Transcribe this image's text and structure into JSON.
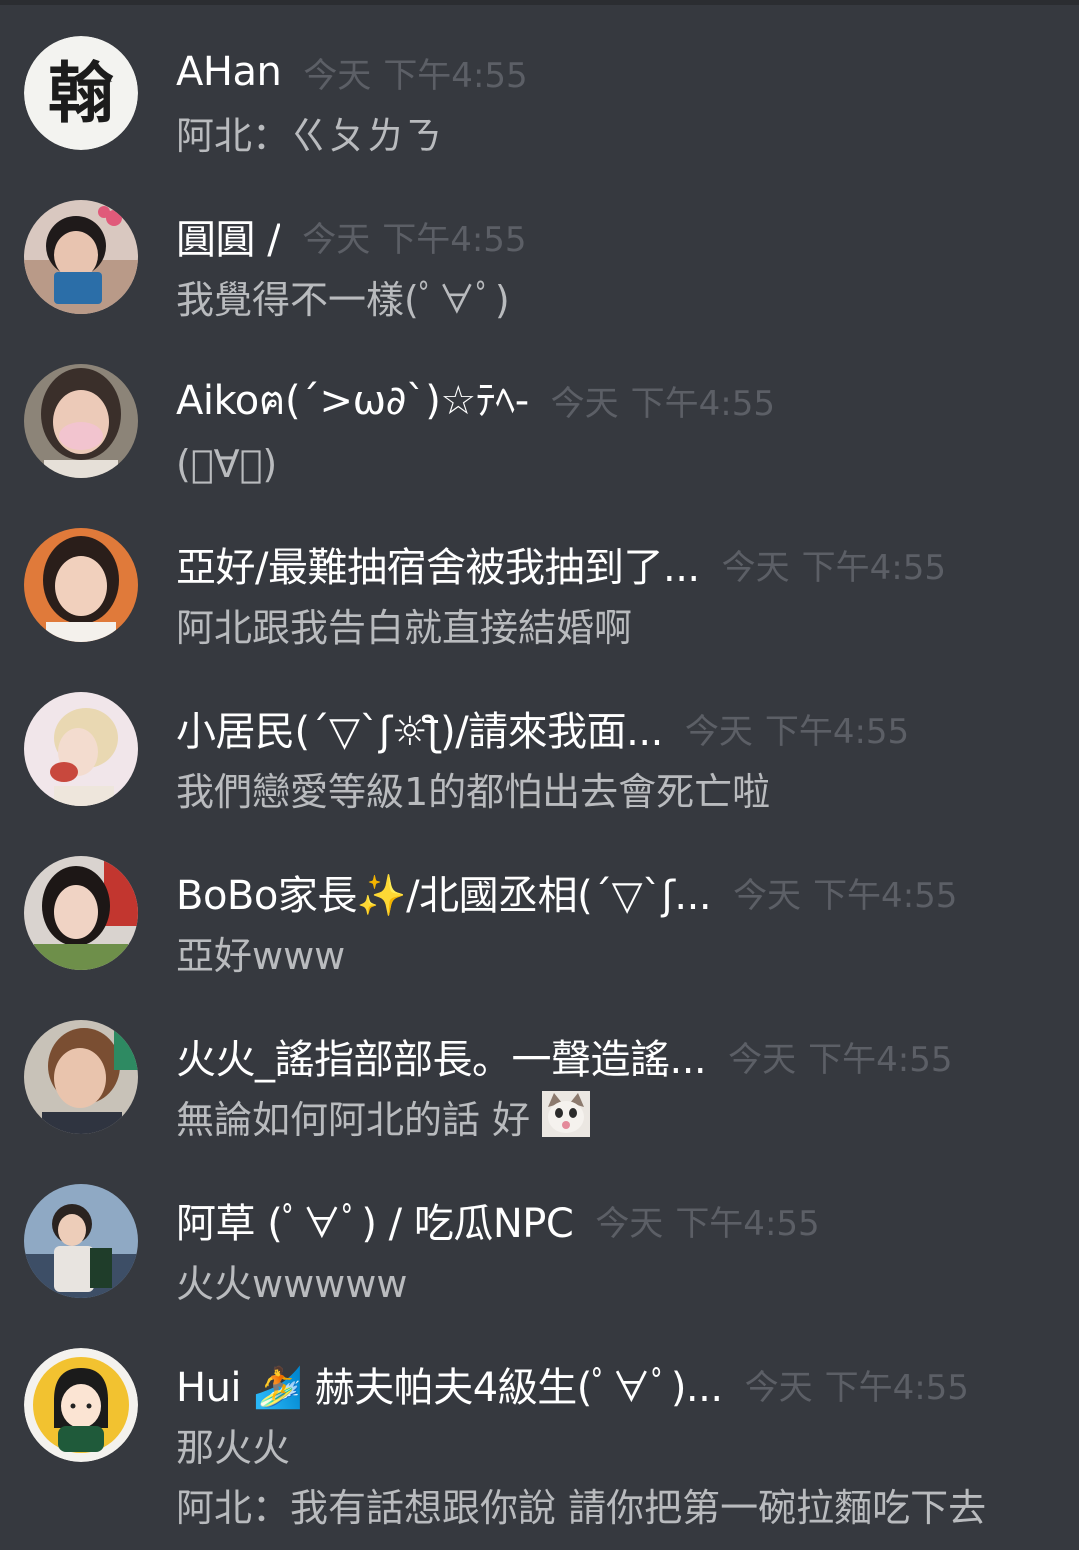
{
  "messages": [
    {
      "username": "AHan",
      "time_day": "今天",
      "time_clock": "下午4:55",
      "lines": [
        "阿北：ㄍㄆㄌㄋ"
      ],
      "avatar_char": "翰"
    },
    {
      "username": "圓圓 /",
      "time_day": "今天",
      "time_clock": "下午4:55",
      "lines": [
        "我覺得不一樣(ﾟ∀ﾟ)"
      ]
    },
    {
      "username": "Aikoฅ(´>ω∂`)☆ﾃﾍ-",
      "time_day": "今天",
      "time_clock": "下午4:55",
      "lines": [
        "(ﾟ∀ﾟ)"
      ]
    },
    {
      "username": "亞好/最難抽宿舍被我抽到了...",
      "time_day": "今天",
      "time_clock": "下午4:55",
      "lines": [
        "阿北跟我告白就直接結婚啊"
      ]
    },
    {
      "username": "小居民(´▽`ʃ☼ƪ)/請來我面...",
      "time_day": "今天",
      "time_clock": "下午4:55",
      "lines": [
        "我們戀愛等級1的都怕出去會死亡啦"
      ]
    },
    {
      "username": "BoBo家長✨/北國丞相(´▽`ʃ...",
      "time_day": "今天",
      "time_clock": "下午4:55",
      "lines": [
        "亞好www"
      ]
    },
    {
      "username": "火火_謠指部部長。一聲造謠...",
      "time_day": "今天",
      "time_clock": "下午4:55",
      "lines": [
        "無論如何阿北的話 好"
      ]
    },
    {
      "username": "阿草 (ﾟ∀ﾟ) / 吃瓜NPC",
      "time_day": "今天",
      "time_clock": "下午4:55",
      "lines": [
        "火火wwwww"
      ]
    },
    {
      "username": "Hui 🏄 赫夫帕夫4級生(ﾟ∀ﾟ)...",
      "time_day": "今天",
      "time_clock": "下午4:55",
      "lines": [
        "那火火",
        "阿北：我有話想跟你說 請你把第一碗拉麵吃下去"
      ]
    }
  ],
  "colors": {
    "background": "#36393f",
    "username": "#ffffff",
    "message_text": "#b9bbbe",
    "timestamp": "#5c5f66"
  },
  "icons": {
    "inline_emoji_message_7": "cat-face-emoji"
  }
}
